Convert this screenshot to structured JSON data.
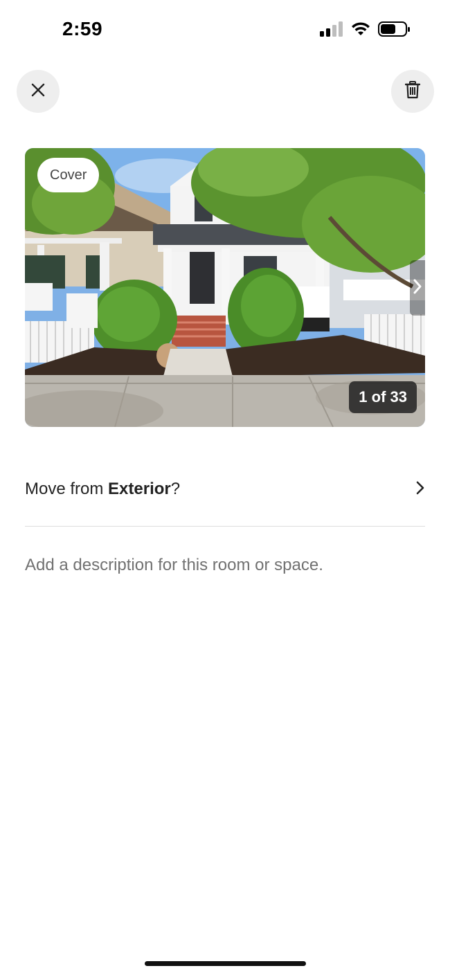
{
  "status_bar": {
    "time": "2:59"
  },
  "header": {
    "close_icon": "close-icon",
    "delete_icon": "trash-icon"
  },
  "photo": {
    "cover_label": "Cover",
    "counter": "1 of 33",
    "next_icon": "chevron-right-icon"
  },
  "move_row": {
    "prefix": "Move from ",
    "room": "Exterior",
    "suffix": "?"
  },
  "description": {
    "placeholder": "Add a description for this room or space.",
    "value": ""
  }
}
